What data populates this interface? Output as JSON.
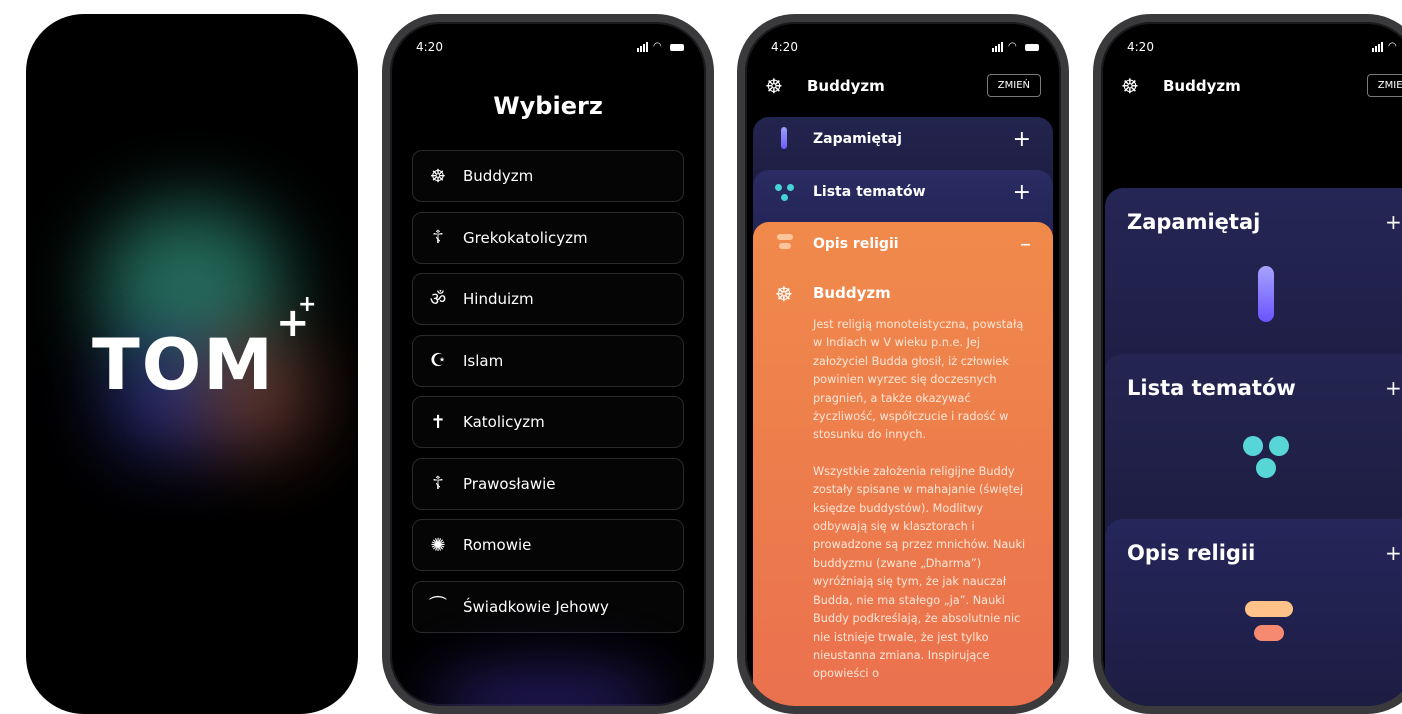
{
  "splash": {
    "logo_text": "TOM",
    "logo_plus": "+",
    "logo_plus_small": "+"
  },
  "status": {
    "time": "4:20"
  },
  "picker": {
    "title": "Wybierz",
    "items": [
      {
        "label": "Buddyzm",
        "icon": "dharma-wheel-icon",
        "glyph": "☸"
      },
      {
        "label": "Grekokatolicyzm",
        "icon": "orthodox-cross-icon",
        "glyph": "☦"
      },
      {
        "label": "Hinduizm",
        "icon": "om-icon",
        "glyph": "ॐ"
      },
      {
        "label": "Islam",
        "icon": "crescent-star-icon",
        "glyph": "☪"
      },
      {
        "label": "Katolicyzm",
        "icon": "latin-cross-icon",
        "glyph": "✝"
      },
      {
        "label": "Prawosławie",
        "icon": "orthodox-cross-icon",
        "glyph": "☦"
      },
      {
        "label": "Romowie",
        "icon": "romani-wheel-icon",
        "glyph": "✺"
      },
      {
        "label": "Świadkowie Jehowy",
        "icon": "bible-icon",
        "glyph": "⏜"
      }
    ]
  },
  "detail": {
    "religion": "Buddyzm",
    "change_label": "ZMIEŃ",
    "sections": [
      {
        "label": "Zapamiętaj",
        "sign": "+"
      },
      {
        "label": "Lista tematów",
        "sign": "+"
      },
      {
        "label": "Opis religii",
        "sign": "–"
      }
    ],
    "description_title": "Buddyzm",
    "paragraphs": [
      "Jest religią monoteistyczna, powstałą w Indiach w V wieku p.n.e. Jej założyciel Budda głosił, iż człowiek powinien wyrzec się doczesnych pragnień, a także okazywać życzliwość, współczucie i radość w stosunku do innych.",
      "Wszystkie założenia religijne Buddy zostały spisane w mahajanie (świętej księdze buddystów). Modlitwy odbywają się w klasztorach i prowadzone są przez mnichów. Nauki buddyzmu (zwane „Dharma”) wyróżniają się tym, że jak nauczał Budda, nie ma stałego „ja”. Nauki Buddy podkreślają, że absolutnie nic nie istnieje trwale, że jest tylko nieustanna zmiana. Inspirujące opowieści o"
    ]
  },
  "overview": {
    "religion": "Buddyzm",
    "change_label": "ZMIEŃ",
    "cards": [
      {
        "label": "Zapamiętaj",
        "sign": "+"
      },
      {
        "label": "Lista tematów",
        "sign": "+"
      },
      {
        "label": "Opis religii",
        "sign": "+"
      }
    ]
  }
}
